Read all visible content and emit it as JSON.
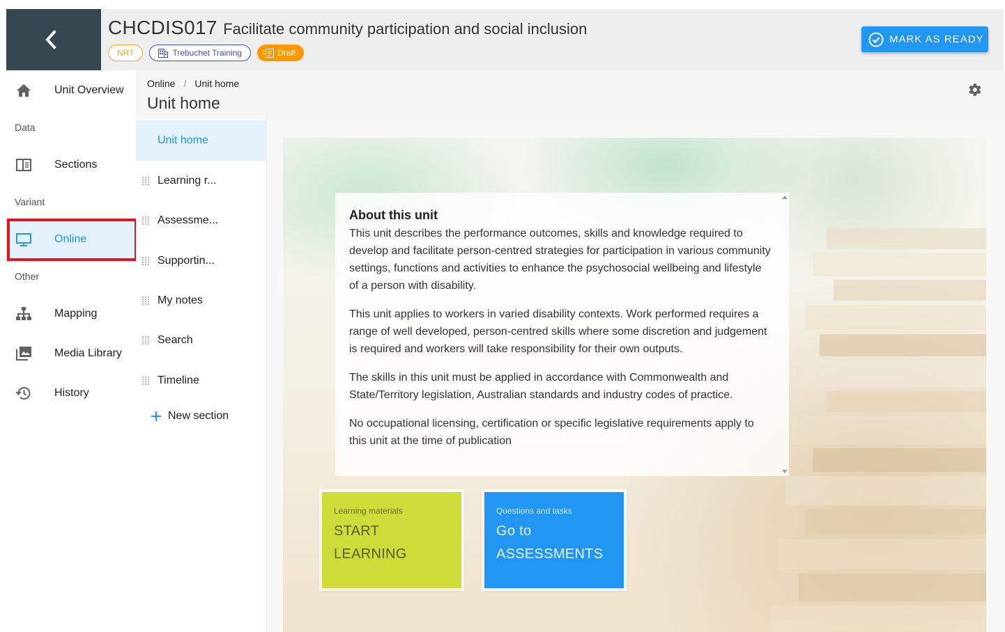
{
  "header": {
    "unit_code": "CHCDIS017",
    "unit_name": "Facilitate community participation and social inclusion",
    "chips": {
      "nrt": "NRT",
      "organisation": "Trebuchet Training",
      "status": "Draft"
    },
    "mark_ready_label": "MARK AS READY"
  },
  "leftnav": {
    "unit_overview": "Unit Overview",
    "group_data": "Data",
    "sections": "Sections",
    "group_variant": "Variant",
    "online": "Online",
    "group_other": "Other",
    "mapping": "Mapping",
    "media_library": "Media Library",
    "history": "History"
  },
  "breadcrumb": {
    "root": "Online",
    "separator": "/",
    "current": "Unit home"
  },
  "page_title": "Unit home",
  "sections": {
    "items": [
      "Unit home",
      "Learning r...",
      "Assessme...",
      "Supportin...",
      "My notes",
      "Search",
      "Timeline"
    ],
    "new_section": "New section"
  },
  "about": {
    "heading": "About this unit",
    "paragraphs": [
      "This unit describes the performance outcomes, skills and knowledge required to develop and facilitate person-centred strategies for participation in various community settings, functions and activities to enhance the psychosocial wellbeing and lifestyle of a person with disability.",
      "This unit applies to workers in varied disability contexts. Work performed requires a range of well developed, person-centred skills where some discretion and judgement is required and workers will take responsibility for their own outputs.",
      "The skills in this unit must be applied in accordance with Commonwealth and State/Territory legislation, Australian standards and industry codes of practice.",
      "No occupational licensing, certification or specific legislative requirements apply to this unit at the time of publication"
    ]
  },
  "tiles": {
    "learning": {
      "caption": "Learning materials",
      "line1": "START",
      "line2": "LEARNING"
    },
    "assessments": {
      "caption": "Questions and tasks",
      "line1": "Go to",
      "line2": "ASSESSMENTS"
    }
  },
  "colors": {
    "accent": "#2196f3",
    "header_dark": "#37474f",
    "draft_chip": "#ff9800",
    "nrt_chip": "#f5a623",
    "learning_tile": "#cddc39",
    "highlight_box": "#e2151b"
  },
  "icons": {
    "back": "chevron-left-icon",
    "unit_overview": "home-icon",
    "sections": "book-open-icon",
    "online": "monitor-icon",
    "mapping": "sitemap-icon",
    "media_library": "image-library-icon",
    "history": "history-icon",
    "settings": "gear-icon",
    "mark_ready": "check-circle-icon"
  }
}
